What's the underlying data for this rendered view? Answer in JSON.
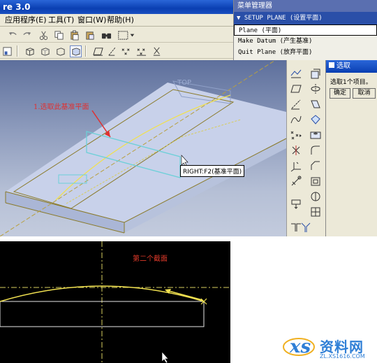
{
  "window": {
    "title": "re 3.0"
  },
  "menubar": {
    "items": [
      "应用程序(E)",
      "工具(T)",
      "窗口(W)",
      "帮助(H)"
    ]
  },
  "toolbar": {
    "icons": [
      "undo-icon",
      "redo-icon",
      "cut-icon",
      "copy-icon",
      "paste-icon",
      "paste-special-icon",
      "find-icon",
      "select-box-icon",
      "model-tree-icon",
      "view-shaded-icon",
      "view-hidden-icon",
      "view-nohidden-icon",
      "view-wireframe-icon",
      "datum-plane-icon",
      "datum-axis-icon",
      "datum-point-icon",
      "datum-csys-icon",
      "datum-point-alt-icon"
    ]
  },
  "menu_manager": {
    "title": "菜单管理器",
    "submenu": "▼ SETUP PLANE (设置平面)",
    "items": [
      {
        "label": "Plane (平面)",
        "selected": true
      },
      {
        "label": "Make Datum (产生基准)",
        "selected": false
      },
      {
        "label": "Quit Plane (放弃平面)",
        "selected": false
      }
    ]
  },
  "viewport": {
    "top_label": "TOP",
    "annotation": "1.选取此基准平面",
    "tooltip": "RIGHT:F2(基准平面)",
    "colors": {
      "part_top": "#c8d1ea",
      "edge": "#8a7a2a",
      "datum": "#6cd0d8",
      "annotation": "#e03030"
    }
  },
  "palette": {
    "icons": [
      "sketch-icon",
      "datum-plane-icon",
      "extrude-icon",
      "revolve-icon",
      "datum-axis-icon",
      "sweep-icon",
      "curve-icon",
      "blend-icon",
      "datum-point-icon",
      "hole-icon",
      "point-offset-icon",
      "round-icon",
      "coord-sys-icon",
      "chamfer-icon",
      "analysis-icon",
      "shell-icon",
      "pattern-icon",
      "rib-icon",
      "draft-icon",
      "mirror-icon",
      "trim-icon"
    ]
  },
  "select_dialog": {
    "title": "选取",
    "message": "选取1个项目。",
    "ok_label": "确定",
    "cancel_label": "取消"
  },
  "sketch": {
    "label": "第二个截面"
  },
  "watermark": {
    "brand": "资料网",
    "url": "ZL.XS1616.COM"
  }
}
